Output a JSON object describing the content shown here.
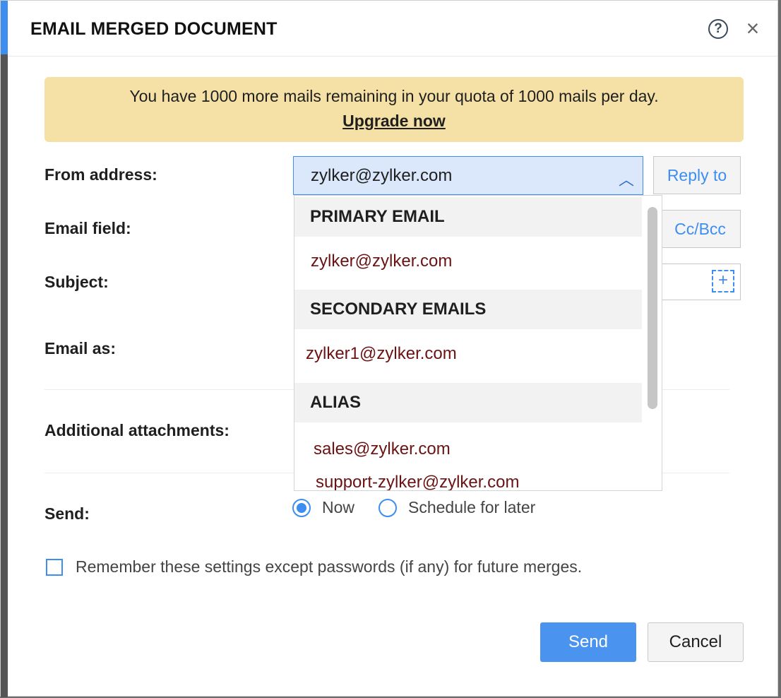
{
  "dialog": {
    "title": "EMAIL MERGED DOCUMENT",
    "help_icon": "question-circle-icon",
    "close_icon": "close-icon",
    "accent_color": "#3d8ef0"
  },
  "quota_banner": {
    "message": "You have 1000 more mails remaining in your quota of 1000 mails per day.",
    "link": "Upgrade now",
    "background": "#f5e1a6"
  },
  "form": {
    "from_label": "From address:",
    "from_value": "zylker@zylker.com",
    "reply_to_label": "Reply to",
    "email_field_label": "Email field:",
    "cc_bcc_label": "Cc/Bcc",
    "subject_label": "Subject:",
    "email_as_label": "Email as:",
    "attachments_label": "Additional attachments:",
    "send_label": "Send:",
    "send_options": [
      {
        "label": "Now",
        "selected": true
      },
      {
        "label": "Schedule for later",
        "selected": false
      }
    ],
    "remember_label": "Remember these settings except passwords (if any) for future merges.",
    "remember_checked": false
  },
  "from_dropdown": {
    "groups": [
      {
        "header": "PRIMARY EMAIL",
        "items": [
          "zylker@zylker.com"
        ]
      },
      {
        "header": "SECONDARY EMAILS",
        "items": [
          "zylker1@zylker.com"
        ]
      },
      {
        "header": "ALIAS",
        "items": [
          "sales@zylker.com",
          "support-zylker@zylker.com"
        ]
      }
    ]
  },
  "actions": {
    "send": "Send",
    "cancel": "Cancel",
    "send_color": "#4a93ee"
  }
}
